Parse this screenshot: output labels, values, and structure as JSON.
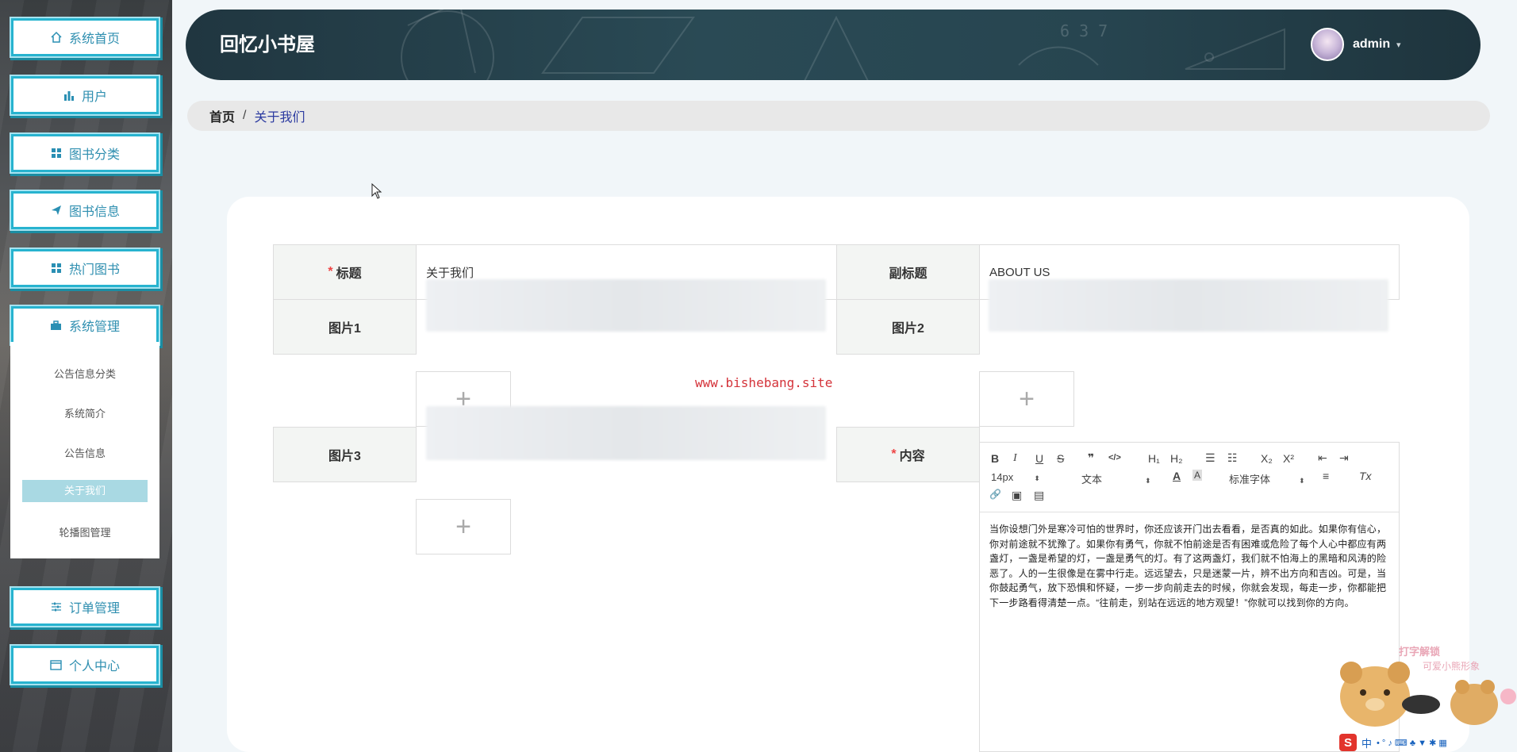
{
  "sidebar": {
    "items": [
      {
        "label": "系统首页",
        "icon": "home-icon"
      },
      {
        "label": "用户",
        "icon": "bar-chart-icon"
      },
      {
        "label": "图书分类",
        "icon": "grid-icon"
      },
      {
        "label": "图书信息",
        "icon": "send-icon"
      },
      {
        "label": "热门图书",
        "icon": "grid-icon"
      },
      {
        "label": "系统管理",
        "icon": "briefcase-icon"
      },
      {
        "label": "订单管理",
        "icon": "sliders-icon"
      },
      {
        "label": "个人中心",
        "icon": "card-icon"
      }
    ],
    "submenu": [
      "公告信息分类",
      "系统简介",
      "公告信息",
      "关于我们",
      "轮播图管理"
    ],
    "active_sub": "关于我们"
  },
  "header": {
    "title": "回忆小书屋",
    "username": "admin",
    "caret": "▾",
    "chalk_numbers": "6 3 7"
  },
  "breadcrumb": {
    "home": "首页",
    "separator": "/",
    "current": "关于我们"
  },
  "form": {
    "title_label": "标题",
    "title_value": "关于我们",
    "subtitle_label": "副标题",
    "subtitle_value": "ABOUT US",
    "pic1_label": "图片1",
    "pic2_label": "图片2",
    "pic3_label": "图片3",
    "content_label": "内容",
    "required_mark": "*",
    "upload_plus": "+"
  },
  "watermark": "www.bishebang.site",
  "editor": {
    "toolbar": {
      "bold": "B",
      "italic": "I",
      "underline": "U",
      "strike": "S",
      "quote": "❞",
      "code": "</>",
      "h1": "H₁",
      "h2": "H₂",
      "ol": "☰",
      "ul": "☷",
      "sub": "X₂",
      "sup": "X²",
      "outdent": "⇤",
      "indent": "⇥",
      "size": "14px",
      "format": "文本",
      "font_color": "A",
      "bg_color": "A",
      "font": "标准字体",
      "align": "≡",
      "clear": "Tx",
      "link": "🔗",
      "image": "▣",
      "video": "▤"
    },
    "content": "当你设想门外是寒冷可怕的世界时，你还应该开门出去看看，是否真的如此。如果你有信心，你对前途就不犹豫了。如果你有勇气，你就不怕前途是否有困难或危险了每个人心中都应有两盏灯，一盏是希望的灯，一盏是勇气的灯。有了这两盏灯，我们就不怕海上的黑暗和风涛的险恶了。人的一生很像是在雾中行走。远远望去，只是迷蒙一片，辨不出方向和吉凶。可是，当你鼓起勇气，放下恐惧和怀疑，一步一步向前走去的时候，你就会发现，每走一步，你都能把下一步路看得清楚一点。“往前走，别站在远远的地方观望！”你就可以找到你的方向。"
  },
  "sticker": {
    "caption1": "打字解锁",
    "caption2": "可爱小熊形象"
  },
  "ime": {
    "logo": "S",
    "lang": "中",
    "symbols": "• ° ♪ ⌨ ♣ ▼ ✱ ▦"
  },
  "colors": {
    "accent": "#27b3cf",
    "header_bg": "#203640",
    "required": "#e44444",
    "watermark": "#d4333a"
  }
}
